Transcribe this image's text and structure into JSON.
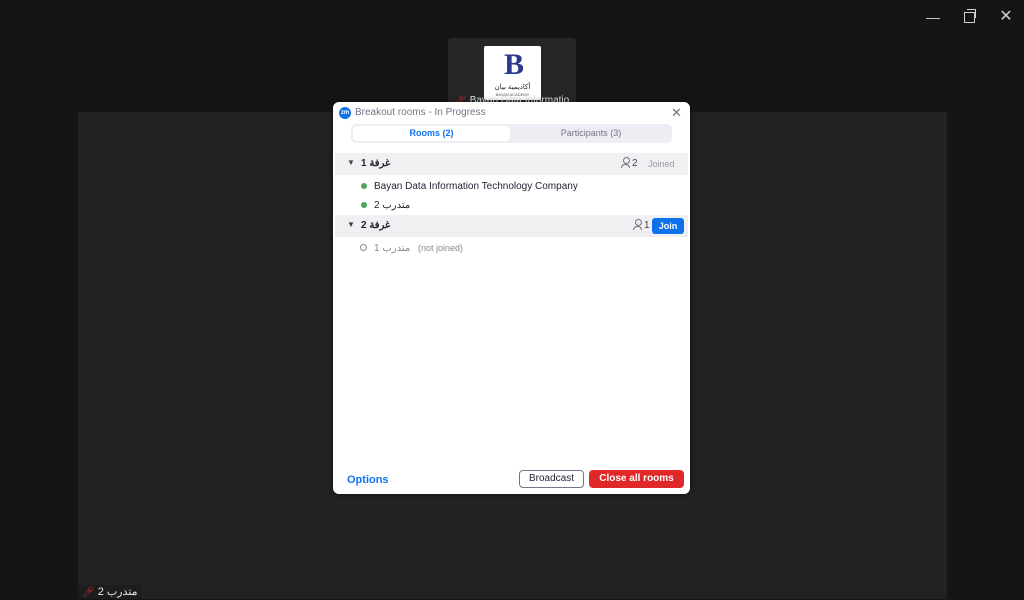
{
  "window": {
    "minimize_icon": "minimize-icon",
    "maximize_icon": "restore-icon",
    "close_icon": "close-icon"
  },
  "thumbnail": {
    "logo_letter": "B",
    "logo_text_ar": "أكاديمية بيان",
    "logo_text_en": "BAYAN ACADEMY",
    "participant_name": "Bayan Data Informatio"
  },
  "self_view": {
    "name": "متدرب 2",
    "mic_icon": "mic-muted-icon"
  },
  "dialog": {
    "title": "Breakout rooms - In Progress",
    "app_icon_text": "zm",
    "tabs": [
      {
        "label": "Rooms (2)",
        "active": true
      },
      {
        "label": "Participants (3)",
        "active": false
      }
    ],
    "rooms": [
      {
        "name": "غرفة 1",
        "count": "2",
        "status": "Joined",
        "members": [
          {
            "name": "Bayan Data Information Technology Company",
            "joined": true
          },
          {
            "name": "متدرب 2",
            "joined": true
          }
        ]
      },
      {
        "name": "غرفة 2",
        "count": "1",
        "action": "Join",
        "members": [
          {
            "name": "متدرب 1",
            "joined": false,
            "note": "(not joined)"
          }
        ]
      }
    ],
    "footer": {
      "options_label": "Options",
      "broadcast_label": "Broadcast",
      "close_all_label": "Close all rooms"
    }
  },
  "colors": {
    "accent": "#0e72ed",
    "danger": "#e02828",
    "online": "#4aa658",
    "background": "#151515"
  }
}
